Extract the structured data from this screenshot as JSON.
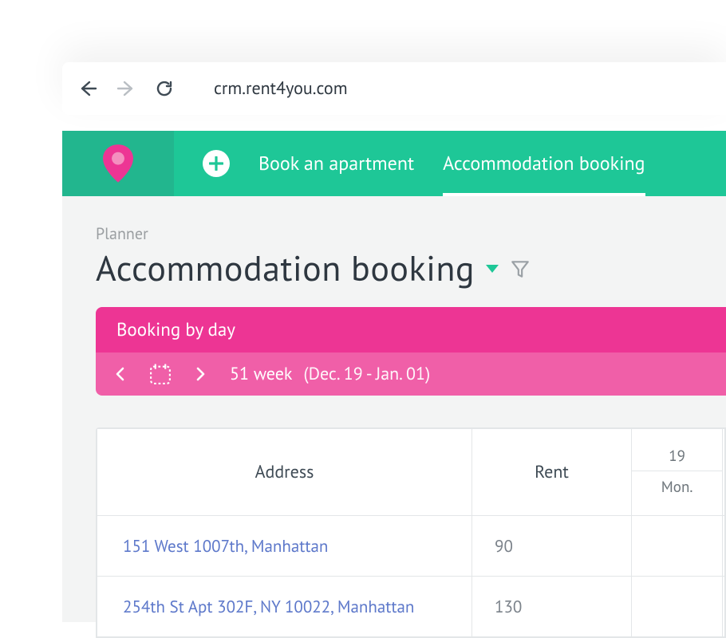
{
  "browser": {
    "url": "crm.rent4you.com"
  },
  "nav": {
    "book_label": "Book an apartment",
    "accom_label": "Accommodation booking"
  },
  "breadcrumb": "Planner",
  "page_title": "Accommodation booking",
  "pink": {
    "heading": "Booking by day",
    "week": "51 week",
    "range": "(Dec. 19 - Jan. 01)"
  },
  "table": {
    "col_address": "Address",
    "col_rent": "Rent",
    "days": [
      {
        "num": "19",
        "dow": "Mon."
      }
    ],
    "rows": [
      {
        "address": "151 West 1007th, Manhattan",
        "rent": "90"
      },
      {
        "address": "254th St Apt 302F, NY 10022, Manhattan",
        "rent": "130"
      }
    ]
  }
}
